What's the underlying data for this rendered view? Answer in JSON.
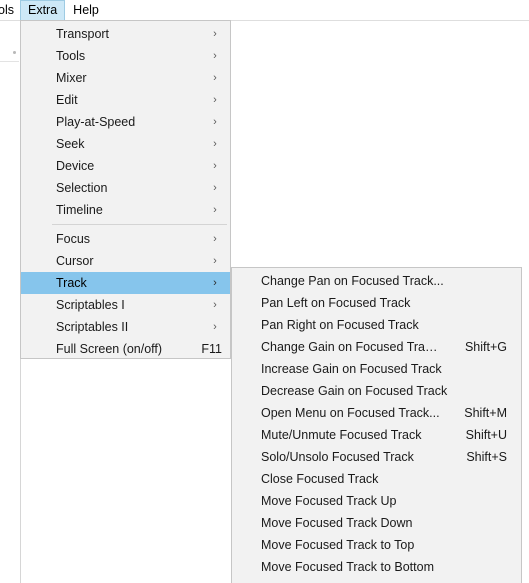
{
  "window": {
    "background_color": "#ffffff"
  },
  "menubar": {
    "items": [
      {
        "label": "ols",
        "clipped": true,
        "active": false
      },
      {
        "label": "Extra",
        "clipped": false,
        "active": true
      },
      {
        "label": "Help",
        "clipped": false,
        "active": false
      }
    ],
    "active_highlight_color": "#cde8f7",
    "active_border_color": "#9ecbe3"
  },
  "menus": {
    "extra": {
      "name": "Extra",
      "selected_item": "Track",
      "selection_color": "#86c5ec",
      "items": [
        {
          "label": "Transport",
          "submenu": true,
          "accel": ""
        },
        {
          "label": "Tools",
          "submenu": true,
          "accel": ""
        },
        {
          "label": "Mixer",
          "submenu": true,
          "accel": ""
        },
        {
          "label": "Edit",
          "submenu": true,
          "accel": ""
        },
        {
          "label": "Play-at-Speed",
          "submenu": true,
          "accel": ""
        },
        {
          "label": "Seek",
          "submenu": true,
          "accel": ""
        },
        {
          "label": "Device",
          "submenu": true,
          "accel": ""
        },
        {
          "label": "Selection",
          "submenu": true,
          "accel": ""
        },
        {
          "label": "Timeline",
          "submenu": true,
          "accel": ""
        },
        {
          "separator": true
        },
        {
          "label": "Focus",
          "submenu": true,
          "accel": ""
        },
        {
          "label": "Cursor",
          "submenu": true,
          "accel": ""
        },
        {
          "label": "Track",
          "submenu": true,
          "accel": "",
          "selected": true
        },
        {
          "label": "Scriptables I",
          "submenu": true,
          "accel": ""
        },
        {
          "label": "Scriptables II",
          "submenu": true,
          "accel": ""
        },
        {
          "label": "Full Screen (on/off)",
          "submenu": false,
          "accel": "F11"
        }
      ]
    },
    "track": {
      "name": "Track",
      "items": [
        {
          "label": "Change Pan on Focused Track...",
          "accel": ""
        },
        {
          "label": "Pan Left on Focused Track",
          "accel": ""
        },
        {
          "label": "Pan Right on Focused Track",
          "accel": ""
        },
        {
          "label": "Change Gain on Focused Track...",
          "accel": "Shift+G"
        },
        {
          "label": "Increase Gain on Focused Track",
          "accel": ""
        },
        {
          "label": "Decrease Gain on Focused Track",
          "accel": ""
        },
        {
          "label": "Open Menu on Focused Track...",
          "accel": "Shift+M"
        },
        {
          "label": "Mute/Unmute Focused Track",
          "accel": "Shift+U"
        },
        {
          "label": "Solo/Unsolo Focused Track",
          "accel": "Shift+S"
        },
        {
          "label": "Close Focused Track",
          "accel": ""
        },
        {
          "label": "Move Focused Track Up",
          "accel": ""
        },
        {
          "label": "Move Focused Track Down",
          "accel": ""
        },
        {
          "label": "Move Focused Track to Top",
          "accel": ""
        },
        {
          "label": "Move Focused Track to Bottom",
          "accel": ""
        }
      ]
    }
  },
  "icons": {
    "submenu_arrow": "chevron-right-icon",
    "submenu_arrow_glyph": "›"
  }
}
